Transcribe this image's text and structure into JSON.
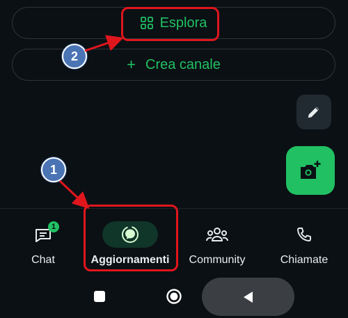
{
  "actions": {
    "explore_label": "Esplora",
    "create_channel_label": "Crea canale",
    "create_channel_prefix": "+"
  },
  "bottom_nav": {
    "items": [
      {
        "label": "Chat",
        "icon": "chat-icon",
        "badge": "1",
        "active": false
      },
      {
        "label": "Aggiornamenti",
        "icon": "updates-icon",
        "active": true
      },
      {
        "label": "Community",
        "icon": "community-icon",
        "active": false
      },
      {
        "label": "Chiamate",
        "icon": "phone-icon",
        "active": false
      }
    ]
  },
  "annotations": {
    "step_1": "1",
    "step_2": "2"
  },
  "fabs": {
    "edit_icon": "pencil-icon",
    "camera_icon": "camera-add-icon"
  },
  "colors": {
    "background": "#0b1014",
    "accent_green": "#21c063",
    "highlight_red": "#e0161d",
    "marker_blue": "#4a74b4"
  }
}
